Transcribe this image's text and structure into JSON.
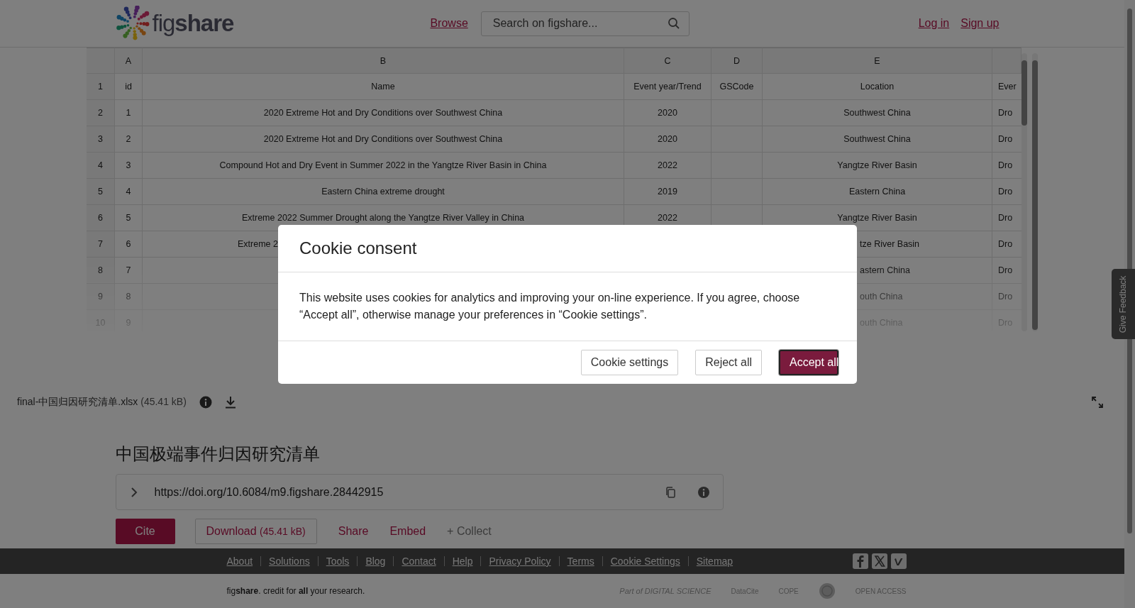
{
  "header": {
    "logo": "fig**share**",
    "browse": "Browse",
    "search": {
      "placeholder": "Search on figshare..."
    },
    "login": "Log in",
    "signup": "Sign up"
  },
  "sheet": {
    "columns": [
      "",
      "A",
      "B",
      "C",
      "D",
      "E",
      ""
    ],
    "rows": [
      {
        "cells": [
          "1",
          "id",
          "Name",
          "Event year/Trend",
          "GSCode",
          "Location",
          "Ever"
        ]
      },
      {
        "cells": [
          "2",
          "1",
          "2020 Extreme Hot and Dry Conditions over Southwest China",
          "2020",
          "",
          "Southwest China",
          "Dro"
        ]
      },
      {
        "cells": [
          "3",
          "2",
          "2020 Extreme Hot and Dry Conditions over Southwest China",
          "2020",
          "",
          "Southwest China",
          "Dro"
        ]
      },
      {
        "cells": [
          "4",
          "3",
          "Compound Hot and Dry Event in Summer 2022 in the Yangtze River Basin in China",
          "2022",
          "",
          "Yangtze River Basin",
          "Dro"
        ]
      },
      {
        "cells": [
          "5",
          "4",
          "Eastern China extreme drought",
          "2019",
          "",
          "Eastern China",
          "Dro"
        ]
      },
      {
        "cells": [
          "6",
          "5",
          "Extreme 2022 Summer Drought along the Yangtze River Valley in China",
          "2022",
          "",
          "Yangtze River Basin",
          "Dro"
        ]
      },
      {
        "kind": "under-modal",
        "cells": [
          "7",
          "6",
          "Extreme 2",
          "",
          "",
          "tze River Basin",
          "Dro"
        ]
      },
      {
        "kind": "under-modal",
        "cells": [
          "8",
          "7",
          "",
          "",
          "",
          "astern China",
          "Dro"
        ]
      },
      {
        "kind": "under-modal",
        "cells": [
          "9",
          "8",
          "",
          "",
          "",
          "outh China",
          "Dro"
        ]
      },
      {
        "kind": "under-modal",
        "cells": [
          "10",
          "9",
          "",
          "",
          "",
          "outh China",
          "Dro"
        ]
      }
    ]
  },
  "file_bar": {
    "filename": "final-中国归因研究清单.xlsx",
    "size": "(45.41 kB)"
  },
  "title": "中国极端事件归因研究清单",
  "doi": "https://doi.org/10.6084/m9.figshare.28442915",
  "actions": [
    {
      "kind": "primary",
      "label": "Cite"
    },
    {
      "kind": "download",
      "label": "Download",
      "size": "(45.41 kB)"
    },
    {
      "kind": "link",
      "label": "Share"
    },
    {
      "kind": "link",
      "label": "Embed"
    },
    {
      "kind": "muted",
      "label": "+ Collect"
    }
  ],
  "footer": {
    "links": [
      "About",
      "Solutions",
      "Tools",
      "Blog",
      "Contact",
      "Help",
      "Privacy Policy",
      "Terms",
      "Cookie Settings",
      "Sitemap"
    ],
    "tagline": "fig**share**. credit for **all** your research.",
    "partners": [
      "Part of DIGITAL SCIENCE",
      "DataCite",
      "COPE",
      "OPEN ACCESS"
    ]
  },
  "feedback": "Give Feedback",
  "cookie_modal": {
    "title": "Cookie consent",
    "body": "This website uses cookies for analytics and improving your on-line experience. If you agree, choose “Accept all”, otherwise manage your preferences in “Cookie settings”.",
    "buttons": [
      {
        "kind": "secondary",
        "label": "Cookie settings"
      },
      {
        "kind": "secondary",
        "label": "Reject all"
      },
      {
        "kind": "primary",
        "label": "Accept all"
      }
    ]
  }
}
